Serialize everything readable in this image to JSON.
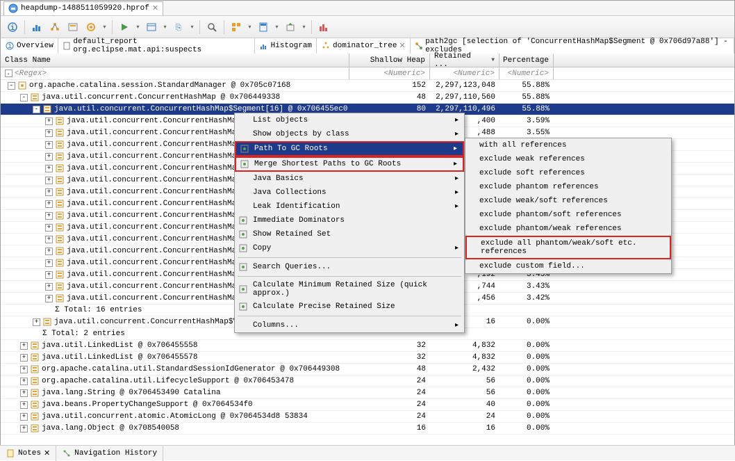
{
  "file_tab": {
    "label": "heapdump-1488511059920.hprof"
  },
  "views": {
    "overview": "Overview",
    "default_report": "default_report  org.eclipse.mat.api:suspects",
    "histogram": "Histogram",
    "dominator": "dominator_tree",
    "path2gc": "path2gc [selection of 'ConcurrentHashMap$Segment @ 0x706d97a88'] -excludes"
  },
  "columns": {
    "c1": "Class Name",
    "c2": "Shallow Heap",
    "c3": "Retained ...",
    "c4": "Percentage",
    "sort": "▼"
  },
  "filters": {
    "c1": "<Regex>",
    "c2": "<Numeric>",
    "c3": "<Numeric>",
    "c4": "<Numeric>"
  },
  "rows": [
    {
      "indent": 0,
      "exp": "-",
      "ico": "obj",
      "text": "org.apache.catalina.session.StandardManager @ 0x705c07168",
      "sh": "152",
      "rh": "2,297,123,048",
      "pct": "55.88%"
    },
    {
      "indent": 1,
      "exp": "-",
      "ico": "pkg",
      "text": "java.util.concurrent.ConcurrentHashMap @ 0x706449338",
      "sh": "48",
      "rh": "2,297,110,560",
      "pct": "55.88%"
    },
    {
      "indent": 2,
      "exp": "-",
      "ico": "pkg",
      "text": "java.util.concurrent.ConcurrentHashMap$Segment[16] @ 0x706455ec0",
      "sh": "80",
      "rh": "2,297,110,496",
      "pct": "55.88%",
      "selected": true
    },
    {
      "indent": 3,
      "exp": "+",
      "ico": "pkg",
      "text": "java.util.concurrent.ConcurrentHashMap",
      "sh": "",
      "rh": ",400",
      "pct": "3.59%"
    },
    {
      "indent": 3,
      "exp": "+",
      "ico": "pkg",
      "text": "java.util.concurrent.ConcurrentHashMap",
      "sh": "",
      "rh": ",488",
      "pct": "3.55%"
    },
    {
      "indent": 3,
      "exp": "+",
      "ico": "pkg",
      "text": "java.util.concurrent.ConcurrentHashMap",
      "sh": "",
      "rh": "",
      "pct": ""
    },
    {
      "indent": 3,
      "exp": "+",
      "ico": "pkg",
      "text": "java.util.concurrent.ConcurrentHashMap",
      "sh": "",
      "rh": "",
      "pct": ""
    },
    {
      "indent": 3,
      "exp": "+",
      "ico": "pkg",
      "text": "java.util.concurrent.ConcurrentHashMap",
      "sh": "",
      "rh": "",
      "pct": ""
    },
    {
      "indent": 3,
      "exp": "+",
      "ico": "pkg",
      "text": "java.util.concurrent.ConcurrentHashMap",
      "sh": "",
      "rh": "",
      "pct": ""
    },
    {
      "indent": 3,
      "exp": "+",
      "ico": "pkg",
      "text": "java.util.concurrent.ConcurrentHashMap",
      "sh": "",
      "rh": "",
      "pct": ""
    },
    {
      "indent": 3,
      "exp": "+",
      "ico": "pkg",
      "text": "java.util.concurrent.ConcurrentHashMap",
      "sh": "",
      "rh": "",
      "pct": ""
    },
    {
      "indent": 3,
      "exp": "+",
      "ico": "pkg",
      "text": "java.util.concurrent.ConcurrentHashMap",
      "sh": "",
      "rh": "",
      "pct": ""
    },
    {
      "indent": 3,
      "exp": "+",
      "ico": "pkg",
      "text": "java.util.concurrent.ConcurrentHashMap",
      "sh": "",
      "rh": "",
      "pct": ""
    },
    {
      "indent": 3,
      "exp": "+",
      "ico": "pkg",
      "text": "java.util.concurrent.ConcurrentHashMap",
      "sh": "",
      "rh": "",
      "pct": ""
    },
    {
      "indent": 3,
      "exp": "+",
      "ico": "pkg",
      "text": "java.util.concurrent.ConcurrentHashMap",
      "sh": "",
      "rh": "",
      "pct": ""
    },
    {
      "indent": 3,
      "exp": "+",
      "ico": "pkg",
      "text": "java.util.concurrent.ConcurrentHashMap",
      "sh": "",
      "rh": ",248",
      "pct": "3.46%"
    },
    {
      "indent": 3,
      "exp": "+",
      "ico": "pkg",
      "text": "java.util.concurrent.ConcurrentHashMap",
      "sh": "",
      "rh": ",192",
      "pct": "3.45%"
    },
    {
      "indent": 3,
      "exp": "+",
      "ico": "pkg",
      "text": "java.util.concurrent.ConcurrentHashMap",
      "sh": "",
      "rh": ",744",
      "pct": "3.43%"
    },
    {
      "indent": 3,
      "exp": "+",
      "ico": "pkg",
      "text": "java.util.concurrent.ConcurrentHashMap",
      "sh": "",
      "rh": ",456",
      "pct": "3.42%"
    },
    {
      "indent": 3,
      "exp": "",
      "ico": "sum",
      "text": "Σ Total: 16 entries",
      "sh": "",
      "rh": "",
      "pct": ""
    },
    {
      "indent": 2,
      "exp": "+",
      "ico": "pkg",
      "text": "java.util.concurrent.ConcurrentHashMap$Values @ 0x707b681a0",
      "sh": "16",
      "rh": "16",
      "pct": "0.00%"
    },
    {
      "indent": 2,
      "exp": "",
      "ico": "sum",
      "text": "Σ Total: 2 entries",
      "sh": "",
      "rh": "",
      "pct": ""
    },
    {
      "indent": 1,
      "exp": "+",
      "ico": "pkg",
      "text": "java.util.LinkedList @ 0x706455558",
      "sh": "32",
      "rh": "4,832",
      "pct": "0.00%"
    },
    {
      "indent": 1,
      "exp": "+",
      "ico": "pkg",
      "text": "java.util.LinkedList @ 0x706455578",
      "sh": "32",
      "rh": "4,832",
      "pct": "0.00%"
    },
    {
      "indent": 1,
      "exp": "+",
      "ico": "pkg",
      "text": "org.apache.catalina.util.StandardSessionIdGenerator @ 0x706449308",
      "sh": "48",
      "rh": "2,432",
      "pct": "0.00%"
    },
    {
      "indent": 1,
      "exp": "+",
      "ico": "pkg",
      "text": "org.apache.catalina.util.LifecycleSupport @ 0x706453478",
      "sh": "24",
      "rh": "56",
      "pct": "0.00%"
    },
    {
      "indent": 1,
      "exp": "+",
      "ico": "pkg",
      "text": "java.lang.String @ 0x706453490  Catalina",
      "sh": "24",
      "rh": "56",
      "pct": "0.00%"
    },
    {
      "indent": 1,
      "exp": "+",
      "ico": "pkg",
      "text": "java.beans.PropertyChangeSupport @ 0x7064534f0",
      "sh": "24",
      "rh": "40",
      "pct": "0.00%"
    },
    {
      "indent": 1,
      "exp": "+",
      "ico": "pkg",
      "text": "java.util.concurrent.atomic.AtomicLong @ 0x7064534d8  53834",
      "sh": "24",
      "rh": "24",
      "pct": "0.00%"
    },
    {
      "indent": 1,
      "exp": "+",
      "ico": "pkg",
      "text": "java.lang.Object @ 0x708540058",
      "sh": "16",
      "rh": "16",
      "pct": "0.00%"
    }
  ],
  "menu": {
    "items": [
      {
        "label": "List objects",
        "arrow": true
      },
      {
        "label": "Show objects by class",
        "arrow": true
      },
      {
        "label": "Path To GC Roots",
        "arrow": true,
        "selected": true,
        "red": true,
        "ico": "gc"
      },
      {
        "label": "Merge Shortest Paths to GC Roots",
        "arrow": true,
        "red": true,
        "ico": "gc"
      },
      {
        "label": "Java Basics",
        "arrow": true
      },
      {
        "label": "Java Collections",
        "arrow": true
      },
      {
        "label": "Leak Identification",
        "arrow": true
      },
      {
        "label": "Immediate Dominators",
        "ico": "dom"
      },
      {
        "label": "Show Retained Set",
        "ico": "ret"
      },
      {
        "label": "Copy",
        "arrow": true,
        "ico": "copy"
      },
      {
        "sep": true
      },
      {
        "label": "Search Queries...",
        "ico": "search"
      },
      {
        "sep": true
      },
      {
        "label": "Calculate Minimum Retained Size (quick approx.)",
        "ico": "calc"
      },
      {
        "label": "Calculate Precise Retained Size",
        "ico": "calc"
      },
      {
        "sep": true
      },
      {
        "label": "Columns...",
        "arrow": true
      }
    ]
  },
  "submenu": {
    "items": [
      {
        "label": "with all references"
      },
      {
        "label": "exclude weak references"
      },
      {
        "label": "exclude soft references"
      },
      {
        "label": "exclude phantom references"
      },
      {
        "label": "exclude weak/soft references"
      },
      {
        "label": "exclude phantom/soft references"
      },
      {
        "label": "exclude phantom/weak references"
      },
      {
        "label": "exclude all phantom/weak/soft etc. references",
        "red": true
      },
      {
        "label": "exclude custom field..."
      }
    ]
  },
  "bottom": {
    "notes": "Notes",
    "nav": "Navigation History"
  }
}
